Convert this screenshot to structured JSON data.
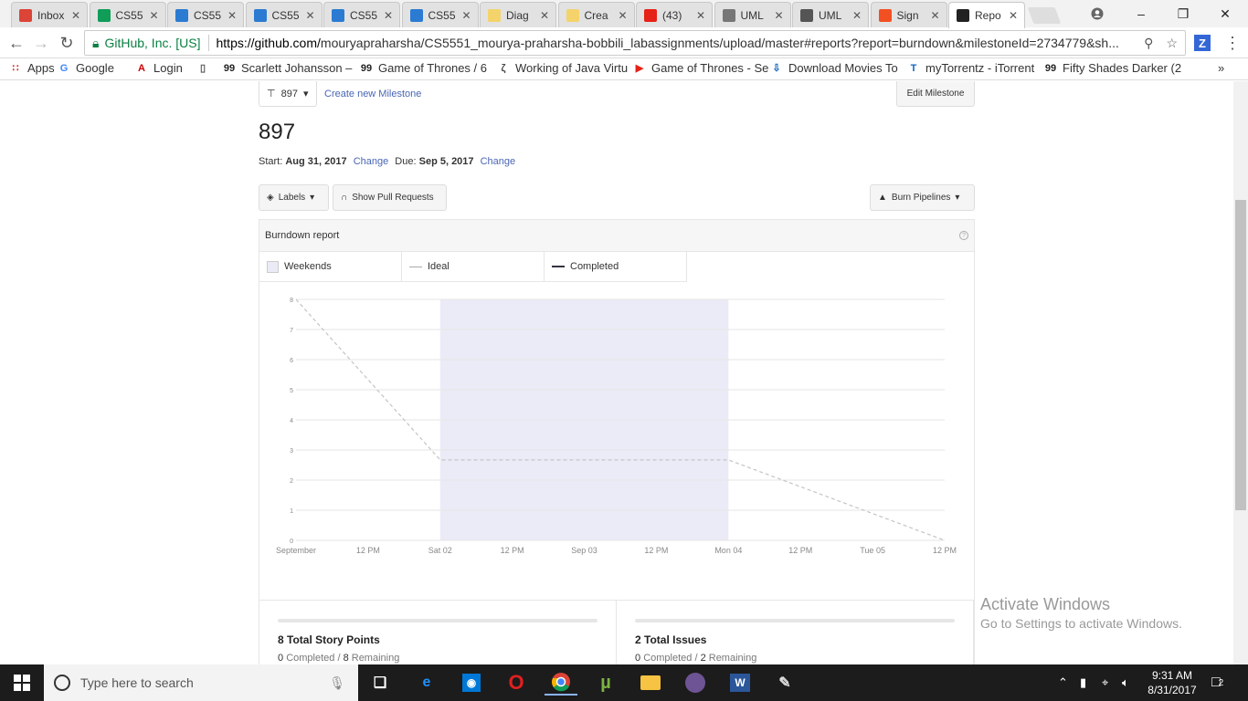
{
  "browser": {
    "tabs": [
      {
        "label": "Inbox",
        "icon": "gmail-icon",
        "color": "#db4437"
      },
      {
        "label": "CS55",
        "icon": "sheets-icon",
        "color": "#0f9d58"
      },
      {
        "label": "CS55",
        "icon": "box-icon",
        "color": "#2a7bd1"
      },
      {
        "label": "CS55",
        "icon": "box-icon",
        "color": "#2a7bd1"
      },
      {
        "label": "CS55",
        "icon": "box-icon",
        "color": "#2a7bd1"
      },
      {
        "label": "CS55",
        "icon": "box-icon",
        "color": "#2a7bd1"
      },
      {
        "label": "Diag",
        "icon": "bulb-icon",
        "color": "#f4d36b"
      },
      {
        "label": "Crea",
        "icon": "bulb-icon",
        "color": "#f4d36b"
      },
      {
        "label": "(43)",
        "icon": "youtube-icon",
        "color": "#e62117"
      },
      {
        "label": "UML",
        "icon": "uml-icon",
        "color": "#777777"
      },
      {
        "label": "UML",
        "icon": "uml2-icon",
        "color": "#555555"
      },
      {
        "label": "Sign",
        "icon": "microsoft-icon",
        "color": "#f25022"
      },
      {
        "label": "Repo",
        "icon": "github-icon",
        "color": "#222222"
      }
    ],
    "secure_label": "GitHub, Inc. [US]",
    "url_prefix": "https://github.com/",
    "url_rest": "mouryapraharsha/CS5551_mourya-praharsha-bobbili_labassignments/upload/master#reports?report=burndown&milestoneId=2734779&sh...",
    "extension_label": "Z",
    "bookmarks": [
      {
        "label": "Apps",
        "icon": "apps-icon"
      },
      {
        "label": "Google",
        "icon": "google-icon"
      },
      {
        "label": "Login",
        "icon": "act-icon"
      },
      {
        "label": "",
        "icon": "page-icon"
      },
      {
        "label": "Scarlett Johansson –",
        "icon": "qq-icon"
      },
      {
        "label": "Game of Thrones / 6",
        "icon": "qq-icon"
      },
      {
        "label": "Working of Java Virtu",
        "icon": "g-icon"
      },
      {
        "label": "Game of Thrones - Se",
        "icon": "youtube-icon"
      },
      {
        "label": "Download Movies To",
        "icon": "download-icon"
      },
      {
        "label": "myTorrentz - iTorrent",
        "icon": "torrent-icon"
      },
      {
        "label": "Fifty Shades Darker (2",
        "icon": "qq-icon"
      }
    ],
    "bookmarks_more": "»"
  },
  "milestone": {
    "selector_label": "897",
    "create_new_label": "Create new Milestone",
    "edit_label": "Edit Milestone",
    "title": "897",
    "start_label": "Start:",
    "start_date": "Aug 31, 2017",
    "due_label": "Due:",
    "due_date": "Sep 5, 2017",
    "change_label": "Change"
  },
  "filters": {
    "labels_btn": "Labels",
    "pull_requests_btn": "Show Pull Requests",
    "pipelines_btn": "Burn Pipelines"
  },
  "report": {
    "title": "Burndown report",
    "help": "?",
    "legend": [
      "Weekends",
      "Ideal",
      "Completed"
    ]
  },
  "chart_data": {
    "type": "line",
    "x_tick_labels": [
      "September",
      "12 PM",
      "Sat 02",
      "12 PM",
      "Sep 03",
      "12 PM",
      "Mon 04",
      "12 PM",
      "Tue 05",
      "12 PM"
    ],
    "y_tick_labels": [
      "0",
      "1",
      "2",
      "3",
      "4",
      "5",
      "6",
      "7",
      "8"
    ],
    "ylim": [
      0,
      8
    ],
    "xlim": [
      0,
      4.5
    ],
    "x_units": "days from Sep 1",
    "weekend_band": {
      "x_start": 1,
      "x_end": 3
    },
    "series": [
      {
        "name": "Ideal",
        "style": "dashed",
        "color": "#c4c4c4",
        "x": [
          0,
          1,
          3,
          4.5
        ],
        "y": [
          8,
          2.67,
          2.67,
          0
        ]
      }
    ],
    "grid": true,
    "colors": {
      "weekend": "#ebebf7",
      "grid": "#e6e6e6",
      "axis_text": "#888888"
    }
  },
  "stats": {
    "story_points": {
      "title": "8 Total Story Points",
      "completed": "0",
      "completed_label": "Completed /",
      "remaining": "8",
      "remaining_label": "Remaining"
    },
    "issues": {
      "title": "2 Total Issues",
      "completed": "0",
      "completed_label": "Completed /",
      "remaining": "2",
      "remaining_label": "Remaining"
    }
  },
  "watermark": {
    "line1": "Activate Windows",
    "line2": "Go to Settings to activate Windows."
  },
  "taskbar": {
    "search_placeholder": "Type here to search",
    "time": "9:31 AM",
    "date": "8/31/2017",
    "notifications": "2"
  }
}
